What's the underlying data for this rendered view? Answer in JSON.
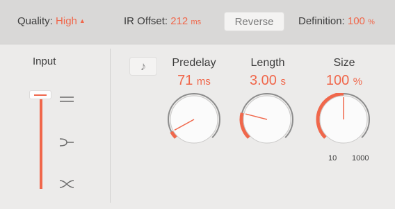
{
  "header": {
    "quality_label": "Quality:",
    "quality_value": "High",
    "ir_offset_label": "IR Offset:",
    "ir_offset_value": "212",
    "ir_offset_unit": "ms",
    "reverse_label": "Reverse",
    "definition_label": "Definition:",
    "definition_value": "100",
    "definition_unit": "%"
  },
  "input": {
    "label": "Input",
    "level": 1.0,
    "modes": [
      "stereo-icon",
      "mono-to-stereo-icon",
      "cross-icon"
    ]
  },
  "knobs": [
    {
      "label": "Predelay",
      "value": "71",
      "unit": "ms",
      "fraction": 0.06
    },
    {
      "label": "Length",
      "value": "3.00",
      "unit": "s",
      "fraction": 0.22
    },
    {
      "label": "Size",
      "value": "100",
      "unit": "%",
      "fraction": 0.5,
      "scale_min": "10",
      "scale_max": "1000"
    }
  ],
  "colors": {
    "accent": "#f0674b",
    "background": "#ecebea",
    "header": "#d9d8d7"
  }
}
